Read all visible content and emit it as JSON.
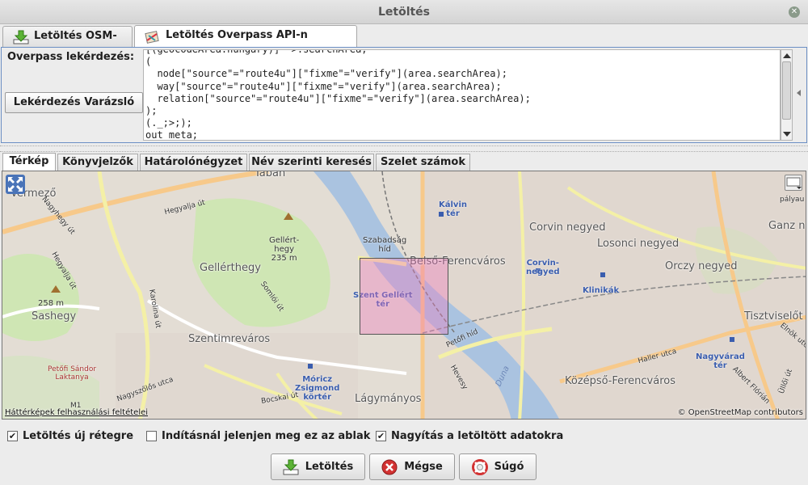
{
  "window": {
    "title": "Letöltés",
    "close_symbol": "✕"
  },
  "top_tabs": [
    {
      "label": "Letöltés OSM-ről",
      "icon": "download-icon"
    },
    {
      "label": "Letöltés Overpass API-n keresztül",
      "icon": "overpass-icon"
    }
  ],
  "query": {
    "label": "Overpass lekérdezés:",
    "wizard_label": "Lekérdezés Varázsló",
    "code": "[(geocodeArea:hungary)] ->.searchArea;\n(\n  node[\"source\"=\"route4u\"][\"fixme\"=\"verify\"](area.searchArea);\n  way[\"source\"=\"route4u\"][\"fixme\"=\"verify\"](area.searchArea);\n  relation[\"source\"=\"route4u\"][\"fixme\"=\"verify\"](area.searchArea);\n);\n(._;>;);\nout meta;"
  },
  "map_tabs": [
    "Térkép",
    "Könyvjelzők",
    "Határolónégyzet",
    "Név szerinti keresés",
    "Szelet számok"
  ],
  "map": {
    "labels": {
      "tabany": "Tabán",
      "vervolgy": "Vérmező",
      "hegyalja": "Hegyalja út",
      "nagyhegy": "Nagyhegy út",
      "gellert_hill": "Gellért-\nhegy\n235 m",
      "gellerthegy": "Gellérthegy",
      "hegyalja_ut2": "Hegyalja út",
      "somlo": "Somlói út",
      "karolina": "Karolina út",
      "m258": "258 m",
      "sashegy": "Sashegy",
      "szentimre": "Szentimreváros",
      "petofi": "Petőfi Sándor\nLaktanya",
      "nagyszolos": "Nagyszőlős utca",
      "m1": "M1",
      "moricz": "Móricz\nZsigmond\nkörtér",
      "bocskai": "Bocskai út",
      "lagymanyos": "Lágymányos",
      "szabadsag": "Szabadság\nhíd",
      "szent_gellert": "Szent Gellért\ntér",
      "belso_ferencvaros": "Belső-Ferencváros",
      "kalvin": "Kálvin\ntér",
      "corvin": "Corvin negyed",
      "corvin_negyed_stop": "Corvin-\nnegyed",
      "losonci": "Losonci negyed",
      "orczy": "Orczy negyed",
      "ganz": "Ganz n",
      "klinikak": "Klinikák",
      "tisztviselo": "Tisztviselőt",
      "elnok": "Elnök utca",
      "haller": "Haller utca",
      "nagyvarad": "Nagyvárad\ntér",
      "kozepso": "Középső-Ferencváros",
      "albert": "Albert Flórián",
      "ulloi": "Üllői út",
      "petofi_hid": "Petőfi híd",
      "duna": "Duna",
      "hengermalom": "Hevesy",
      "palyau": "pályau"
    },
    "attribution_left": "Háttérképek felhasználási feltételei",
    "attribution_right": "© OpenStreetMap contributors",
    "selection_color": "#f078be"
  },
  "options": [
    {
      "label": "Letöltés új rétegre",
      "checked": true,
      "mark": "✔"
    },
    {
      "label": "Indításnál jelenjen meg ez az ablak",
      "checked": false,
      "mark": ""
    },
    {
      "label": "Nagyítás a letöltött adatokra",
      "checked": true,
      "mark": "✔"
    }
  ],
  "buttons": {
    "download": "Letöltés",
    "cancel": "Mégse",
    "help": "Súgó"
  },
  "colors": {
    "accent": "#6b8fc4",
    "river": "#aac3e0",
    "cancel_red": "#d23232"
  }
}
